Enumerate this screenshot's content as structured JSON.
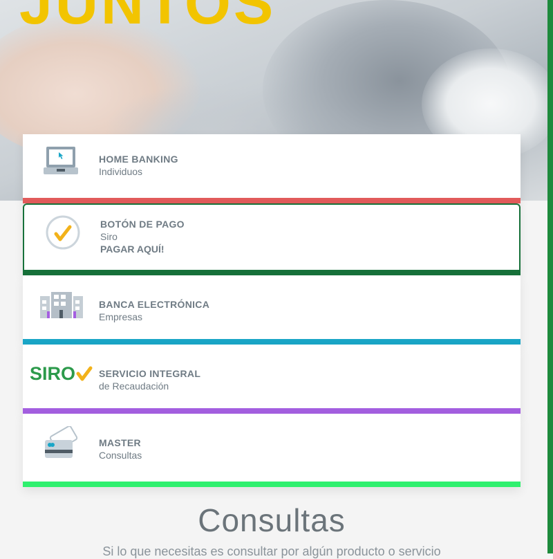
{
  "hero": {
    "title": "JUNTOS"
  },
  "cards": [
    {
      "title": "HOME BANKING",
      "subtitle": "Individuos",
      "icon": "laptop-icon",
      "bar_color": "#e25b5b"
    },
    {
      "title": "BOTÓN DE PAGO",
      "subtitle": "Siro",
      "action": "PAGAR AQUÍ!",
      "icon": "check-circle-icon",
      "bar_color": "#17713a"
    },
    {
      "title": "BANCA ELECTRÓNICA",
      "subtitle": "Empresas",
      "icon": "building-icon",
      "bar_color": "#1aa6c7"
    },
    {
      "title": "SERVICIO INTEGRAL",
      "subtitle": "de Recaudación",
      "icon": "siro-logo",
      "logo_text": "SIRO",
      "bar_color": "#a45fe0"
    },
    {
      "title": "MASTER",
      "subtitle": "Consultas",
      "icon": "credit-card-icon",
      "bar_color": "#2ff06e"
    }
  ],
  "consultas": {
    "title": "Consultas",
    "subtitle": "Si lo que necesitas es consultar por algún producto o servicio"
  }
}
